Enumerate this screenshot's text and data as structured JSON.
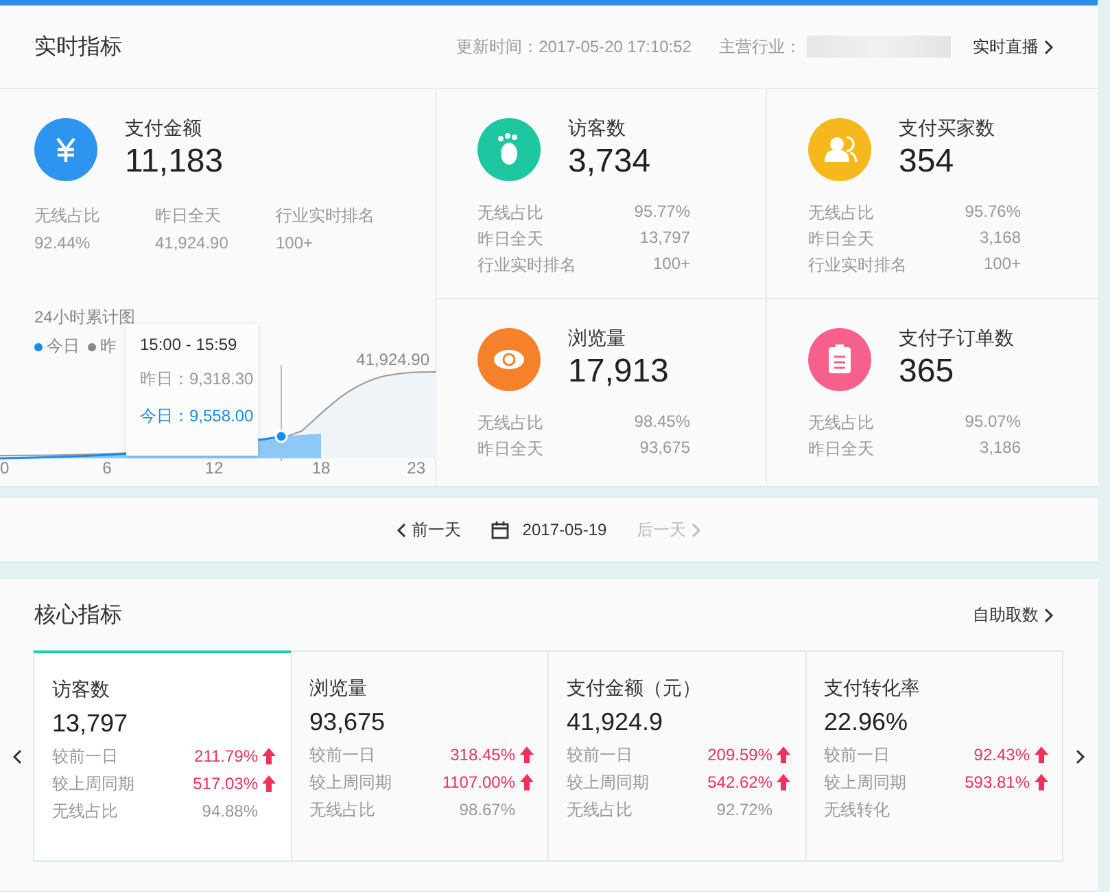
{
  "realtime": {
    "title": "实时指标",
    "update_time": "更新时间：2017-05-20 17:10:52",
    "industry_label": "主营行业：",
    "live_link": "实时直播",
    "main_metric": {
      "color": "#2d95f0",
      "label": "支付金额",
      "value": "11,183",
      "stats": [
        {
          "label": "无线占比",
          "value": "92.44%"
        },
        {
          "label": "昨日全天",
          "value": "41,924.90"
        },
        {
          "label": "行业实时排名",
          "value": "100+"
        }
      ]
    },
    "chart": {
      "title": "24小时累计图",
      "legend": [
        {
          "label": "今日",
          "color": "#1a8cf0"
        },
        {
          "label": "昨",
          "color": "#888888"
        }
      ],
      "peak_label": "41,924.90",
      "x_labels": [
        "0",
        "6",
        "12",
        "18",
        "23"
      ],
      "tooltip": {
        "time": "15:00 - 15:59",
        "yesterday": "昨日：9,318.30",
        "today": "今日：9,558.00"
      }
    },
    "metrics": [
      {
        "color": "#1cc79f",
        "label": "访客数",
        "value": "3,734",
        "stats": [
          {
            "label": "无线占比",
            "value": "95.77%"
          },
          {
            "label": "昨日全天",
            "value": "13,797"
          },
          {
            "label": "行业实时排名",
            "value": "100+"
          }
        ]
      },
      {
        "color": "#f6b81c",
        "label": "支付买家数",
        "value": "354",
        "stats": [
          {
            "label": "无线占比",
            "value": "95.76%"
          },
          {
            "label": "昨日全天",
            "value": "3,168"
          },
          {
            "label": "行业实时排名",
            "value": "100+"
          }
        ]
      },
      {
        "color": "#f5822a",
        "label": "浏览量",
        "value": "17,913",
        "stats": [
          {
            "label": "无线占比",
            "value": "98.45%"
          },
          {
            "label": "昨日全天",
            "value": "93,675"
          }
        ]
      },
      {
        "color": "#f6608d",
        "label": "支付子订单数",
        "value": "365",
        "stats": [
          {
            "label": "无线占比",
            "value": "95.07%"
          },
          {
            "label": "昨日全天",
            "value": "3,186"
          }
        ]
      }
    ]
  },
  "date_nav": {
    "prev": "前一天",
    "date": "2017-05-19",
    "next": "后一天",
    "next_disabled": true
  },
  "core": {
    "title": "核心指标",
    "link": "自助取数",
    "cards": [
      {
        "label": "访客数",
        "value": "13,797",
        "selected": true,
        "rows": [
          {
            "label": "较前一日",
            "value": "211.79%",
            "rising": true
          },
          {
            "label": "较上周同期",
            "value": "517.03%",
            "rising": true
          },
          {
            "label": "无线占比",
            "value": "94.88%",
            "rising": false
          }
        ]
      },
      {
        "label": "浏览量",
        "value": "93,675",
        "selected": false,
        "rows": [
          {
            "label": "较前一日",
            "value": "318.45%",
            "rising": true
          },
          {
            "label": "较上周同期",
            "value": "1107.00%",
            "rising": true
          },
          {
            "label": "无线占比",
            "value": "98.67%",
            "rising": false
          }
        ]
      },
      {
        "label": "支付金额（元）",
        "value": "41,924.9",
        "selected": false,
        "rows": [
          {
            "label": "较前一日",
            "value": "209.59%",
            "rising": true
          },
          {
            "label": "较上周同期",
            "value": "542.62%",
            "rising": true
          },
          {
            "label": "无线占比",
            "value": "92.72%",
            "rising": false
          }
        ]
      },
      {
        "label": "支付转化率",
        "value": "22.96%",
        "selected": false,
        "rows": [
          {
            "label": "较前一日",
            "value": "92.43%",
            "rising": true
          },
          {
            "label": "较上周同期",
            "value": "593.81%",
            "rising": true
          },
          {
            "label": "无线转化"
          }
        ]
      }
    ]
  }
}
